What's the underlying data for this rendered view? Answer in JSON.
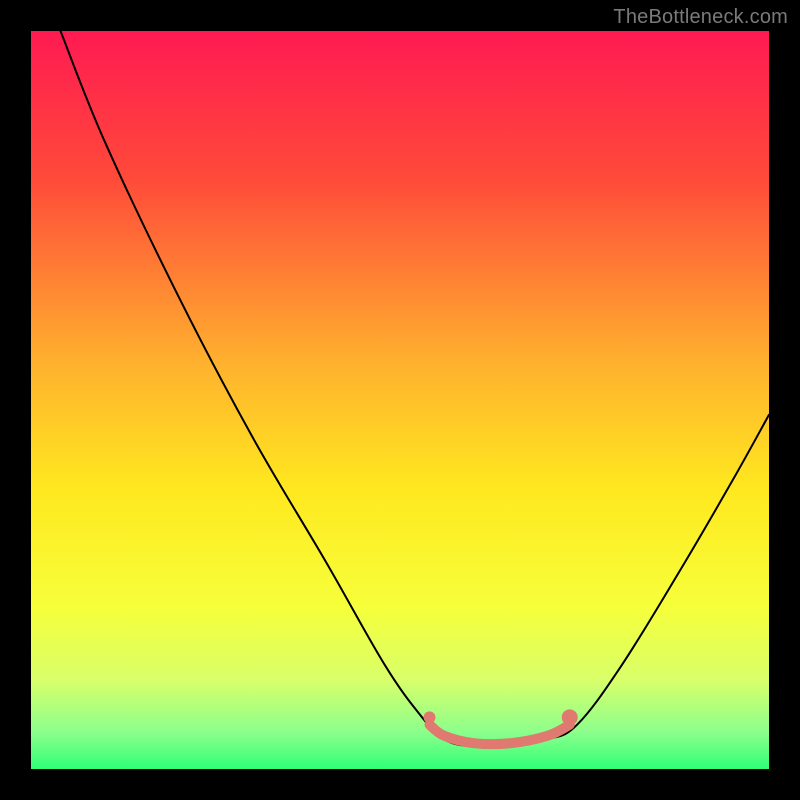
{
  "watermark": "TheBottleneck.com",
  "chart_data": {
    "type": "line",
    "title": "",
    "xlabel": "",
    "ylabel": "",
    "xlim": [
      0,
      100
    ],
    "ylim": [
      0,
      100
    ],
    "gradient_stops": [
      {
        "offset": 0,
        "color": "#ff1a52"
      },
      {
        "offset": 20,
        "color": "#ff4a3a"
      },
      {
        "offset": 45,
        "color": "#ffb12e"
      },
      {
        "offset": 62,
        "color": "#ffe81f"
      },
      {
        "offset": 78,
        "color": "#f6ff3a"
      },
      {
        "offset": 88,
        "color": "#d8ff6a"
      },
      {
        "offset": 95,
        "color": "#8cff8c"
      },
      {
        "offset": 100,
        "color": "#2fff76"
      }
    ],
    "series": [
      {
        "name": "bottleneck-curve",
        "color": "#000000",
        "stroke_width": 2,
        "points": [
          {
            "x": 4,
            "y": 100
          },
          {
            "x": 10,
            "y": 85
          },
          {
            "x": 20,
            "y": 64
          },
          {
            "x": 30,
            "y": 45
          },
          {
            "x": 40,
            "y": 28
          },
          {
            "x": 48,
            "y": 14
          },
          {
            "x": 53,
            "y": 7
          },
          {
            "x": 56,
            "y": 4
          },
          {
            "x": 60,
            "y": 3
          },
          {
            "x": 65,
            "y": 3
          },
          {
            "x": 70,
            "y": 4
          },
          {
            "x": 74,
            "y": 6
          },
          {
            "x": 80,
            "y": 14
          },
          {
            "x": 88,
            "y": 27
          },
          {
            "x": 95,
            "y": 39
          },
          {
            "x": 100,
            "y": 48
          }
        ]
      },
      {
        "name": "highlight-trough",
        "color": "#e07a70",
        "stroke_width": 10,
        "points": [
          {
            "x": 54,
            "y": 6
          },
          {
            "x": 56,
            "y": 4.5
          },
          {
            "x": 60,
            "y": 3.5
          },
          {
            "x": 65,
            "y": 3.5
          },
          {
            "x": 70,
            "y": 4.5
          },
          {
            "x": 73,
            "y": 6
          }
        ]
      }
    ],
    "dots": [
      {
        "x": 54,
        "y": 7,
        "r": 6,
        "color": "#e07a70"
      },
      {
        "x": 73,
        "y": 7,
        "r": 8,
        "color": "#e07a70"
      }
    ]
  }
}
